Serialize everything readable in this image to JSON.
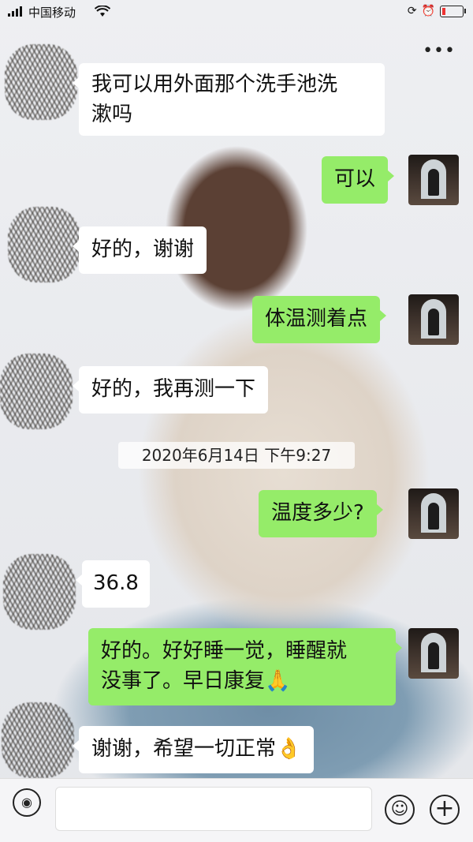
{
  "status_bar": {
    "carrier": "中国移动"
  },
  "messages": [
    {
      "side": "in",
      "text": "我可以用外面那个洗手池洗"
    },
    {
      "side": "in",
      "text": "漱吗"
    },
    {
      "side": "out",
      "text": "可以"
    },
    {
      "side": "in",
      "text": "好的，谢谢"
    },
    {
      "side": "out",
      "text": "体温测着点"
    },
    {
      "side": "in",
      "text": "好的，我再测一下"
    },
    {
      "side": "out",
      "text": "温度多少?"
    },
    {
      "side": "in",
      "text": "36.8"
    },
    {
      "side": "out",
      "text": "好的。好好睡一觉，睡醒就"
    },
    {
      "side": "out",
      "text": "没事了。早日康复🙏"
    },
    {
      "side": "in",
      "text": "谢谢，希望一切正常👌"
    }
  ],
  "timestamp": "2020年6月14日 下午9:27",
  "input_bar": {
    "placeholder": ""
  },
  "icons": {
    "more": "more-options-icon",
    "voice": "voice-icon",
    "emoji": "emoji-icon",
    "plus": "plus-icon"
  }
}
